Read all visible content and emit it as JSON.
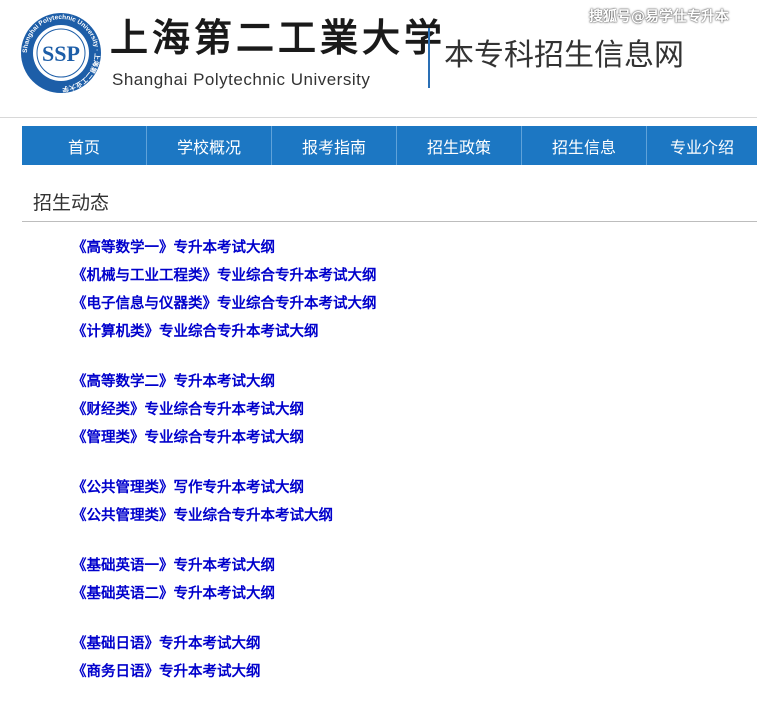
{
  "header": {
    "seal_text": "Shanghai Polytechnic University · 上海第二工业大学",
    "seal_letters": "SSP",
    "univ_name_cn": "上海第二工業大学",
    "univ_name_en": "Shanghai  Polytechnic  University",
    "site_title": "本专科招生信息网",
    "watermark": "搜狐号@易学仕专升本",
    "accent_color": "#2a6fb5"
  },
  "nav": {
    "background_color": "#1c77c3",
    "items": [
      {
        "label": "首页"
      },
      {
        "label": "学校概况"
      },
      {
        "label": "报考指南"
      },
      {
        "label": "招生政策"
      },
      {
        "label": "招生信息"
      },
      {
        "label": "专业介绍"
      }
    ]
  },
  "section": {
    "title": "招生动态",
    "groups": [
      {
        "links": [
          "《高等数学一》专升本考试大纲",
          "《机械与工业工程类》专业综合专升本考试大纲",
          "《电子信息与仪器类》专业综合专升本考试大纲",
          "《计算机类》专业综合专升本考试大纲"
        ]
      },
      {
        "links": [
          "《高等数学二》专升本考试大纲",
          "《财经类》专业综合专升本考试大纲",
          "《管理类》专业综合专升本考试大纲"
        ]
      },
      {
        "links": [
          "《公共管理类》写作专升本考试大纲",
          "《公共管理类》专业综合专升本考试大纲"
        ]
      },
      {
        "links": [
          "《基础英语一》专升本考试大纲",
          "《基础英语二》专升本考试大纲"
        ]
      },
      {
        "links": [
          "《基础日语》专升本考试大纲",
          "《商务日语》专升本考试大纲"
        ]
      }
    ],
    "link_color": "#0000cc"
  }
}
